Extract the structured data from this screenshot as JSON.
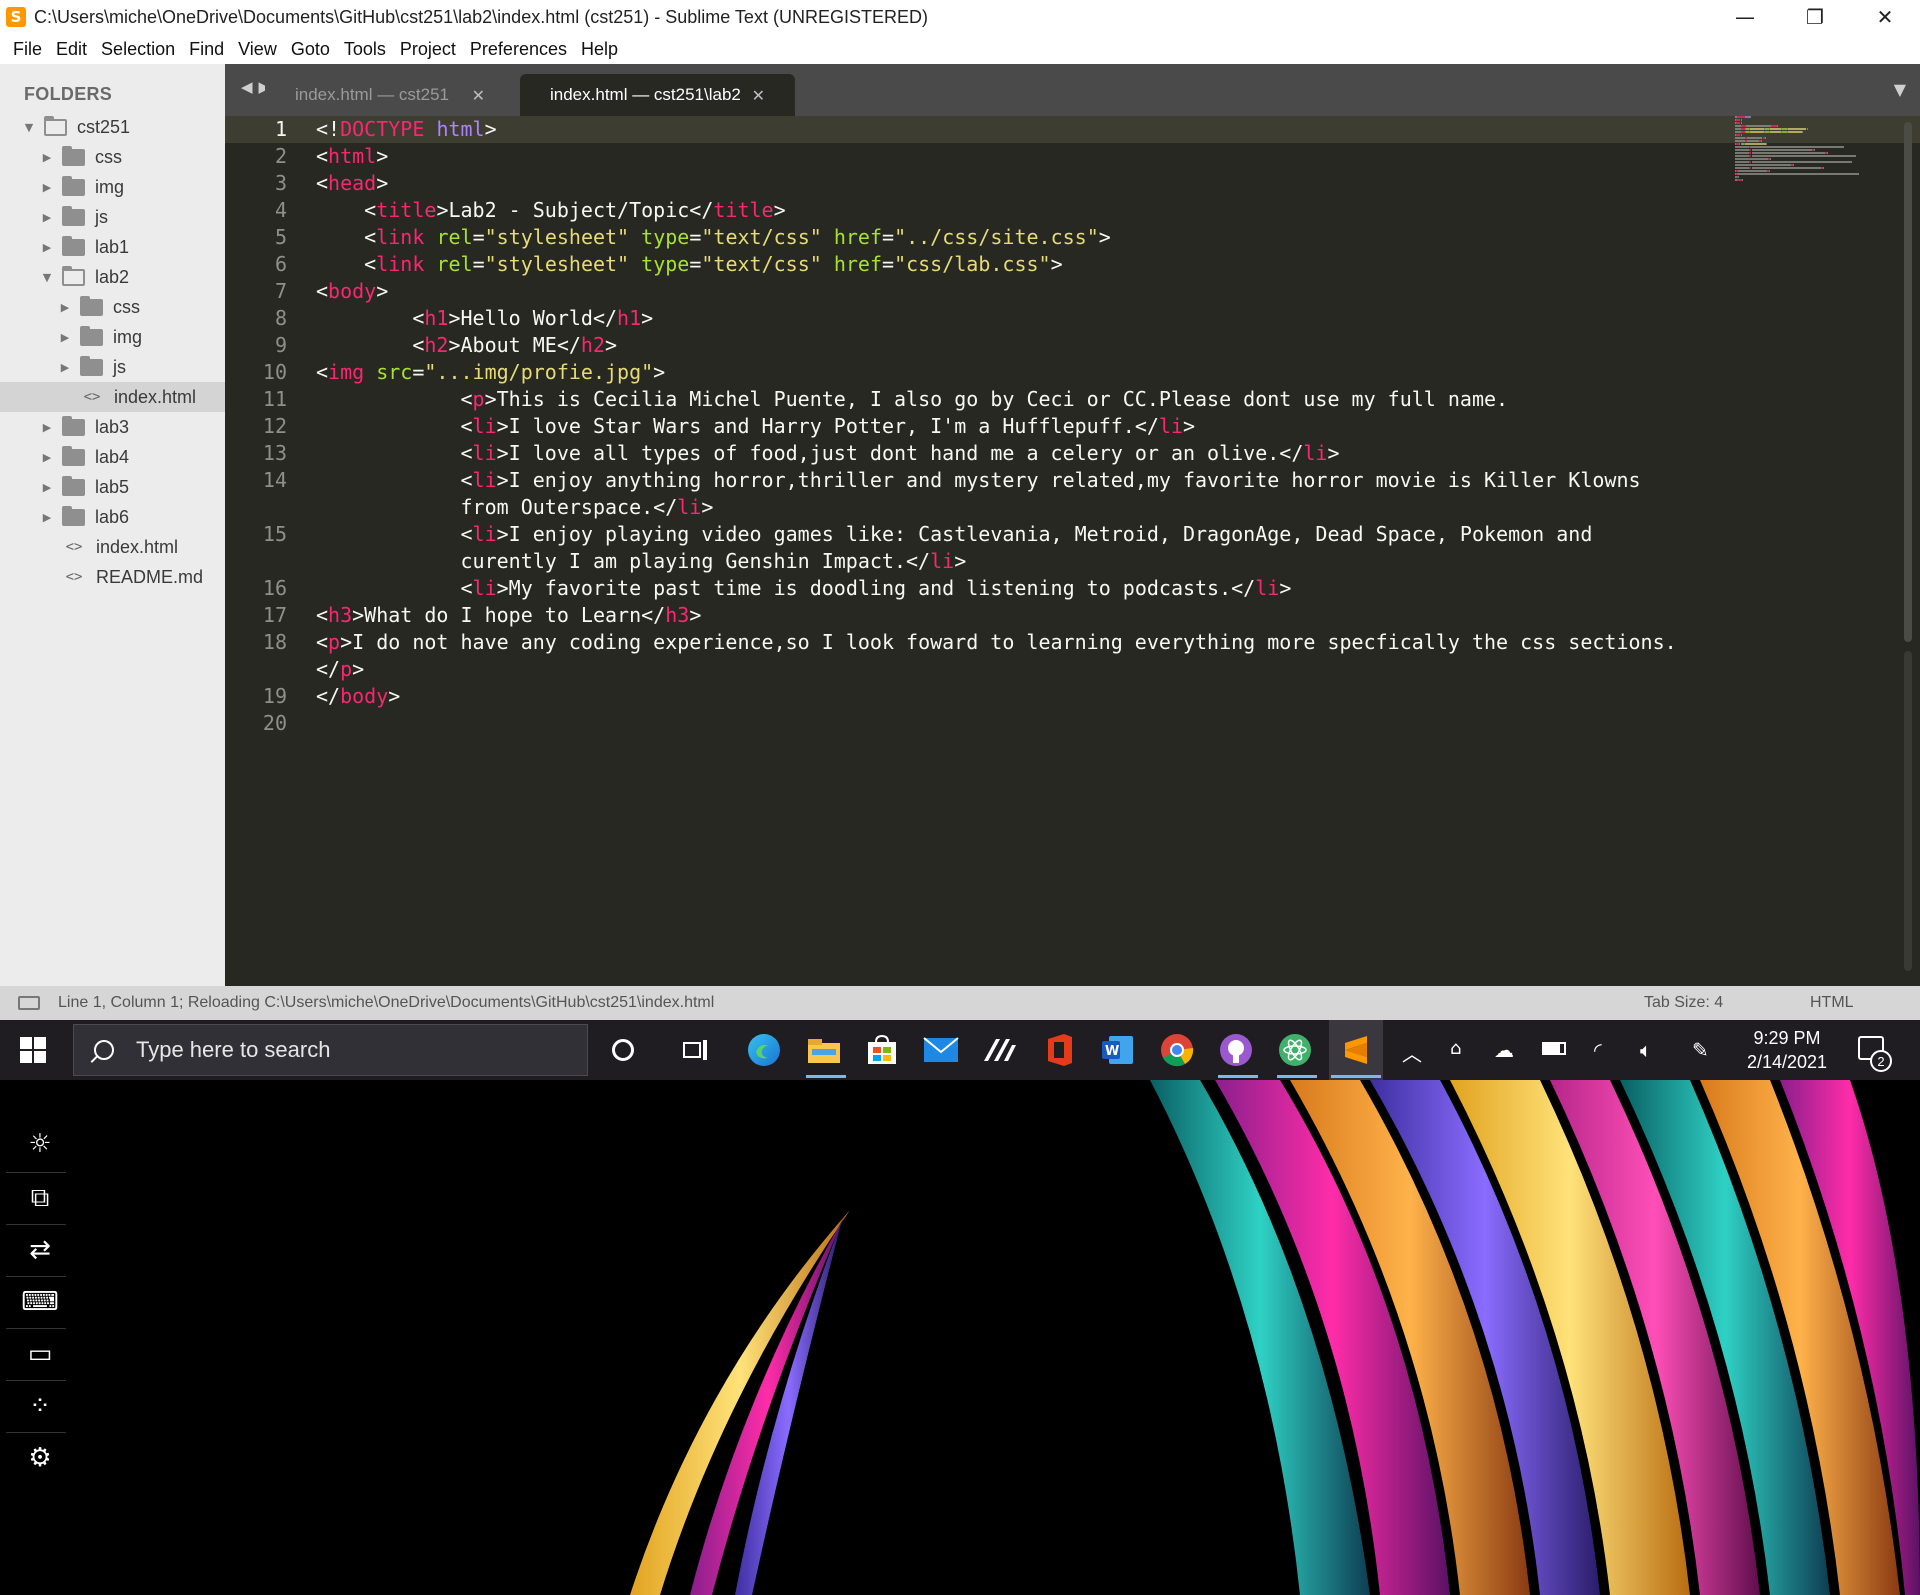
{
  "window": {
    "title": "C:\\Users\\miche\\OneDrive\\Documents\\GitHub\\cst251\\lab2\\index.html (cst251) - Sublime Text (UNREGISTERED)",
    "app_icon_glyph": "S",
    "controls": {
      "minimize": "—",
      "restore": "❐",
      "close": "✕"
    }
  },
  "menu": [
    "File",
    "Edit",
    "Selection",
    "Find",
    "View",
    "Goto",
    "Tools",
    "Project",
    "Preferences",
    "Help"
  ],
  "sidebar": {
    "header": "FOLDERS",
    "items": [
      {
        "label": "cst251",
        "type": "folder-open",
        "level": 0
      },
      {
        "label": "css",
        "type": "folder",
        "level": 1
      },
      {
        "label": "img",
        "type": "folder",
        "level": 1
      },
      {
        "label": "js",
        "type": "folder",
        "level": 1
      },
      {
        "label": "lab1",
        "type": "folder",
        "level": 1
      },
      {
        "label": "lab2",
        "type": "folder-open",
        "level": 1
      },
      {
        "label": "css",
        "type": "folder",
        "level": 2
      },
      {
        "label": "img",
        "type": "folder",
        "level": 2
      },
      {
        "label": "js",
        "type": "folder",
        "level": 2
      },
      {
        "label": "index.html",
        "type": "file",
        "level": 2,
        "selected": true
      },
      {
        "label": "lab3",
        "type": "folder",
        "level": 1
      },
      {
        "label": "lab4",
        "type": "folder",
        "level": 1
      },
      {
        "label": "lab5",
        "type": "folder",
        "level": 1
      },
      {
        "label": "lab6",
        "type": "folder",
        "level": 1
      },
      {
        "label": "index.html",
        "type": "file",
        "level": 1
      },
      {
        "label": "README.md",
        "type": "file",
        "level": 1
      }
    ]
  },
  "tabs": [
    {
      "label": "index.html — cst251",
      "active": false,
      "close": "✕"
    },
    {
      "label": "index.html — cst251\\lab2",
      "active": true,
      "close": "✕"
    }
  ],
  "editor": {
    "current_line": 1,
    "line_numbers": [
      "1",
      "2",
      "3",
      "4",
      "5",
      "6",
      "7",
      "8",
      "9",
      "10",
      "11",
      "12",
      "13",
      "14",
      "",
      "15",
      "",
      "16",
      "17",
      "18",
      "",
      "19",
      "20"
    ],
    "code_lines": [
      [
        [
          "p",
          "<!"
        ],
        [
          "t",
          "DOCTYPE"
        ],
        [
          "p",
          " "
        ],
        [
          "k",
          "html"
        ],
        [
          "p",
          ">"
        ]
      ],
      [
        [
          "p",
          "<"
        ],
        [
          "t",
          "html"
        ],
        [
          "p",
          ">"
        ]
      ],
      [
        [
          "p",
          "<"
        ],
        [
          "t",
          "head"
        ],
        [
          "p",
          ">"
        ]
      ],
      [
        [
          "p",
          "    <"
        ],
        [
          "t",
          "title"
        ],
        [
          "p",
          ">Lab2 - Subject/Topic</"
        ],
        [
          "t",
          "title"
        ],
        [
          "p",
          ">"
        ]
      ],
      [
        [
          "p",
          "    <"
        ],
        [
          "t",
          "link"
        ],
        [
          "p",
          " "
        ],
        [
          "a",
          "rel"
        ],
        [
          "p",
          "="
        ],
        [
          "s",
          "\"stylesheet\""
        ],
        [
          "p",
          " "
        ],
        [
          "a",
          "type"
        ],
        [
          "p",
          "="
        ],
        [
          "s",
          "\"text/css\""
        ],
        [
          "p",
          " "
        ],
        [
          "a",
          "href"
        ],
        [
          "p",
          "="
        ],
        [
          "s",
          "\"../css/site.css\""
        ],
        [
          "p",
          ">"
        ]
      ],
      [
        [
          "p",
          "    <"
        ],
        [
          "t",
          "link"
        ],
        [
          "p",
          " "
        ],
        [
          "a",
          "rel"
        ],
        [
          "p",
          "="
        ],
        [
          "s",
          "\"stylesheet\""
        ],
        [
          "p",
          " "
        ],
        [
          "a",
          "type"
        ],
        [
          "p",
          "="
        ],
        [
          "s",
          "\"text/css\""
        ],
        [
          "p",
          " "
        ],
        [
          "a",
          "href"
        ],
        [
          "p",
          "="
        ],
        [
          "s",
          "\"css/lab.css\""
        ],
        [
          "p",
          ">"
        ]
      ],
      [
        [
          "p",
          "<"
        ],
        [
          "t",
          "body"
        ],
        [
          "p",
          ">"
        ]
      ],
      [
        [
          "p",
          "        <"
        ],
        [
          "t",
          "h1"
        ],
        [
          "p",
          ">Hello World</"
        ],
        [
          "t",
          "h1"
        ],
        [
          "p",
          ">"
        ]
      ],
      [
        [
          "p",
          "        <"
        ],
        [
          "t",
          "h2"
        ],
        [
          "p",
          ">About ME</"
        ],
        [
          "t",
          "h2"
        ],
        [
          "p",
          ">"
        ]
      ],
      [
        [
          "p",
          "<"
        ],
        [
          "t",
          "img"
        ],
        [
          "p",
          " "
        ],
        [
          "a",
          "src"
        ],
        [
          "p",
          "="
        ],
        [
          "s",
          "\"...img/profie.jpg\""
        ],
        [
          "p",
          ">"
        ]
      ],
      [
        [
          "p",
          "            <"
        ],
        [
          "t",
          "p"
        ],
        [
          "p",
          ">This is Cecilia Michel Puente, I also go by Ceci or CC.Please dont use my full name."
        ]
      ],
      [
        [
          "p",
          "            <"
        ],
        [
          "t",
          "li"
        ],
        [
          "p",
          ">I love Star Wars and Harry Potter, I'm a Hufflepuff.</"
        ],
        [
          "t",
          "li"
        ],
        [
          "p",
          ">"
        ]
      ],
      [
        [
          "p",
          "            <"
        ],
        [
          "t",
          "li"
        ],
        [
          "p",
          ">I love all types of food,just dont hand me a celery or an olive.</"
        ],
        [
          "t",
          "li"
        ],
        [
          "p",
          ">"
        ]
      ],
      [
        [
          "p",
          "            <"
        ],
        [
          "t",
          "li"
        ],
        [
          "p",
          ">I enjoy anything horror,thriller and mystery related,my favorite horror movie is Killer Klowns"
        ]
      ],
      [
        [
          "p",
          "            from Outerspace.</"
        ],
        [
          "t",
          "li"
        ],
        [
          "p",
          ">"
        ]
      ],
      [
        [
          "p",
          "            <"
        ],
        [
          "t",
          "li"
        ],
        [
          "p",
          ">I enjoy playing video games like: Castlevania, Metroid, DragonAge, Dead Space, Pokemon and"
        ]
      ],
      [
        [
          "p",
          "            curently I am playing Genshin Impact.</"
        ],
        [
          "t",
          "li"
        ],
        [
          "p",
          ">"
        ]
      ],
      [
        [
          "p",
          "            <"
        ],
        [
          "t",
          "li"
        ],
        [
          "p",
          ">My favorite past time is doodling and listening to podcasts.</"
        ],
        [
          "t",
          "li"
        ],
        [
          "p",
          ">"
        ]
      ],
      [
        [
          "p",
          "<"
        ],
        [
          "t",
          "h3"
        ],
        [
          "p",
          ">What do I hope to Learn</"
        ],
        [
          "t",
          "h3"
        ],
        [
          "p",
          ">"
        ]
      ],
      [
        [
          "p",
          "<"
        ],
        [
          "t",
          "p"
        ],
        [
          "p",
          ">I do not have any coding experience,so I look foward to learning everything more specfically the css sections."
        ]
      ],
      [
        [
          "p",
          "</"
        ],
        [
          "t",
          "p"
        ],
        [
          "p",
          ">"
        ]
      ],
      [
        [
          "p",
          "</"
        ],
        [
          "t",
          "body"
        ],
        [
          "p",
          ">"
        ]
      ],
      [
        [
          "p",
          ""
        ]
      ]
    ]
  },
  "statusbar": {
    "text": "Line 1, Column 1; Reloading C:\\Users\\miche\\OneDrive\\Documents\\GitHub\\cst251\\index.html",
    "tab_size": "Tab Size: 4",
    "syntax": "HTML"
  },
  "taskbar": {
    "search_placeholder": "Type here to search",
    "time": "9:29 PM",
    "date": "2/14/2021",
    "notification_count": "2",
    "apps": [
      "cortana-icon",
      "task-view-icon",
      "edge-icon",
      "file-explorer-icon",
      "store-icon",
      "mail-icon",
      "app-icon",
      "office-icon",
      "word-icon",
      "chrome-icon",
      "github-desktop-icon",
      "atom-icon",
      "sublime-text-icon"
    ],
    "tray": [
      "chevron-up-icon",
      "meet-now-icon",
      "onedrive-icon",
      "battery-icon",
      "wifi-icon",
      "volume-icon",
      "pen-icon"
    ]
  },
  "desktop": {
    "side_actions": [
      "brightness-icon",
      "project-icon",
      "connect-icon",
      "keyboard-icon",
      "display-icon",
      "apps-icon",
      "settings-icon"
    ]
  },
  "colors": {
    "editor_bg": "#272822",
    "tag": "#f92672",
    "attribute": "#a6e22e",
    "string": "#e6db74",
    "keyword": "#ae81ff"
  }
}
